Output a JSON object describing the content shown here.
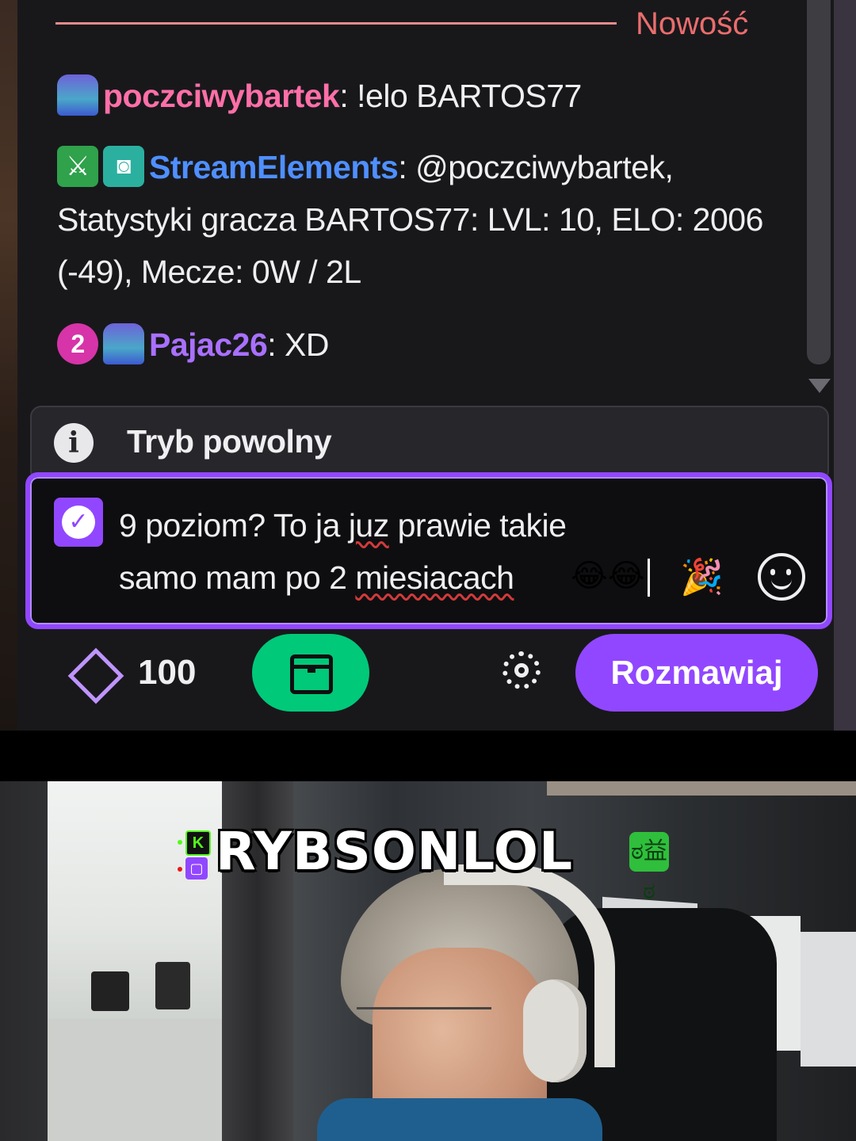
{
  "chat": {
    "new_label": "Nowość",
    "messages": [
      {
        "badges": [
          "prime-icon"
        ],
        "username": "poczciwybartek",
        "username_color": "#ff6fa8",
        "separator": ":",
        "text": " !elo BARTOS77"
      },
      {
        "badges": [
          "sword-icon",
          "robot-icon"
        ],
        "username": "StreamElements",
        "username_color": "#4f8fff",
        "separator": ":",
        "text": " @poczciwybartek, Statystyki gracza BARTOS77: LVL: 10, ELO: 2006 (-49), Mecze: 0W / 2L"
      },
      {
        "badges": [
          "sub-badge-2",
          "prime-icon"
        ],
        "sub_badge_label": "2",
        "username": "Pajac26",
        "username_color": "#a970ff",
        "separator": ":",
        "text": " XD"
      }
    ]
  },
  "slow_mode": {
    "label": "Tryb powolny"
  },
  "input": {
    "line1_prefix": "9 poziom? To ja ",
    "line1_misspelled": "juz",
    "line1_suffix": " prawie takie",
    "line2_prefix": "samo mam po 2 ",
    "line2_misspelled": "miesiacach",
    "emotes": "😂😂"
  },
  "bottom_bar": {
    "points": "100",
    "chat_button": "Rozmawiaj"
  },
  "stream": {
    "streamer_name": "RYBSONLOL",
    "kick_letter": "K",
    "twitch_glyph": "▢"
  },
  "colors": {
    "accent": "#9147ff",
    "chest": "#00c979",
    "background": "#18181b"
  }
}
